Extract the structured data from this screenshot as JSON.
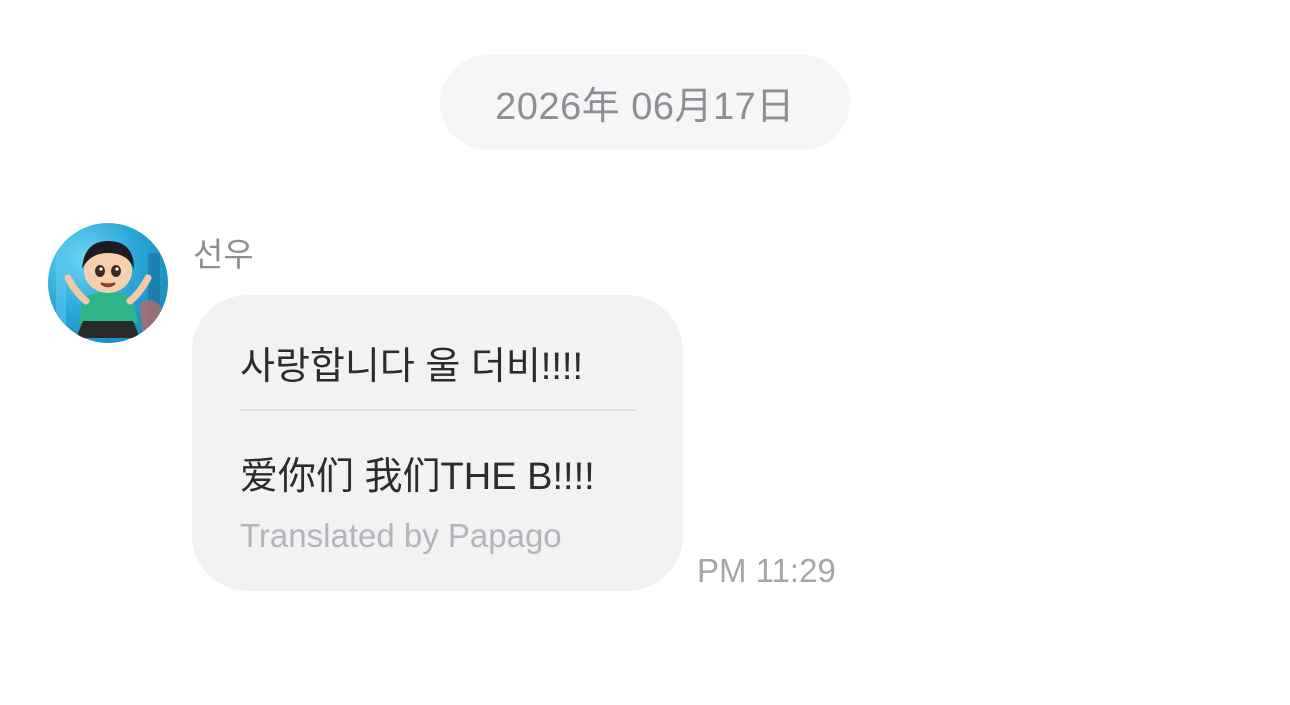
{
  "date_separator": "2026年 06月17日",
  "message": {
    "sender_name": "선우",
    "original_text": "사랑합니다 울 더비!!!!",
    "translated_text": "爱你们 我们THE B!!!!",
    "translation_credit": "Translated by Papago",
    "time": "PM 11:29"
  },
  "colors": {
    "bubble_background": "#f2f2f4",
    "date_pill_background": "#f6f6f8",
    "secondary_text": "#8e8e93",
    "primary_text": "#2c2c2e"
  },
  "icons": {
    "avatar": "sender-avatar-cartoon-girl"
  }
}
